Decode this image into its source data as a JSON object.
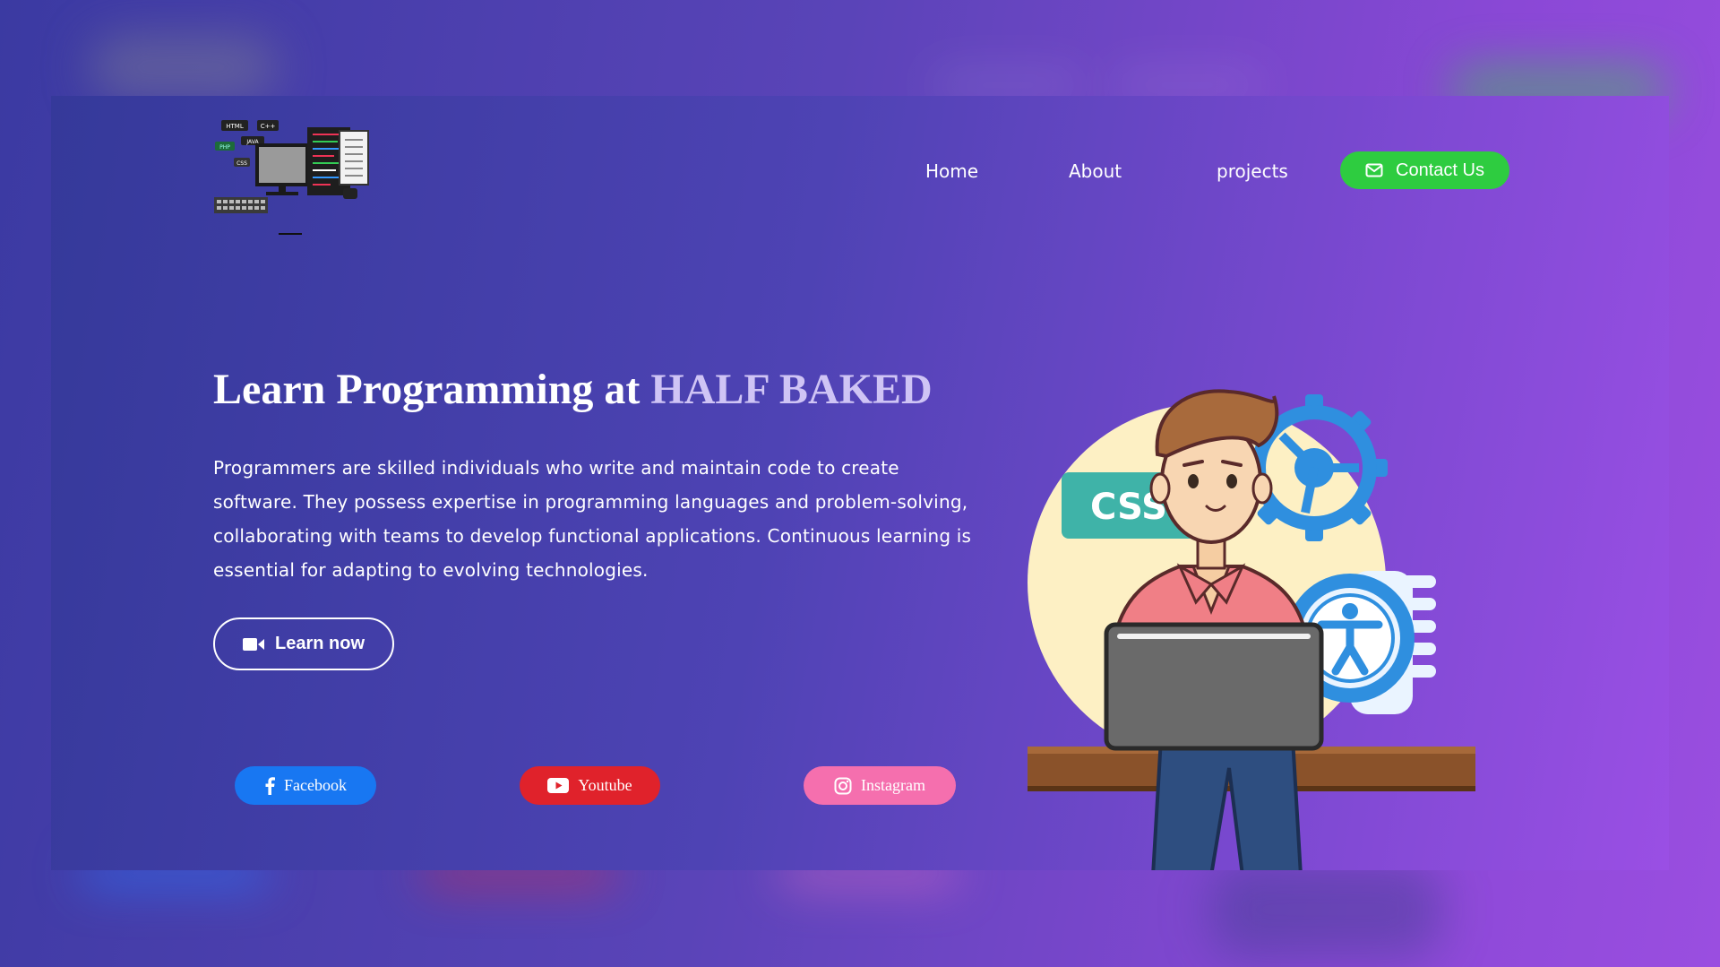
{
  "logo": {
    "labels": [
      "HTML",
      "C++",
      "PHP",
      "JAVA",
      "CSS"
    ]
  },
  "nav": {
    "home": "Home",
    "about": "About",
    "projects": "projects",
    "contact": "Contact Us"
  },
  "hero": {
    "title_prefix": "Learn Programming at ",
    "title_accent": "HALF BAKED",
    "description": "Programmers are skilled individuals who write and maintain code to create software. They possess expertise in programming languages and problem-solving, collaborating with teams to develop functional applications. Continuous learning is essential for adapting to evolving technologies.",
    "cta": "Learn now"
  },
  "social": {
    "facebook": "Facebook",
    "youtube": "Youtube",
    "instagram": "Instagram"
  },
  "illustration": {
    "badge": "CSS"
  },
  "icons": {
    "mail": "mail-icon",
    "video": "video-camera-icon",
    "facebook": "facebook-icon",
    "youtube": "youtube-icon",
    "instagram": "instagram-icon"
  },
  "colors": {
    "contact_bg": "#2ecc40",
    "facebook_bg": "#1877f2",
    "youtube_bg": "#e0222b",
    "instagram_bg": "#f56fae",
    "accent_text": "#cfc4f5"
  }
}
